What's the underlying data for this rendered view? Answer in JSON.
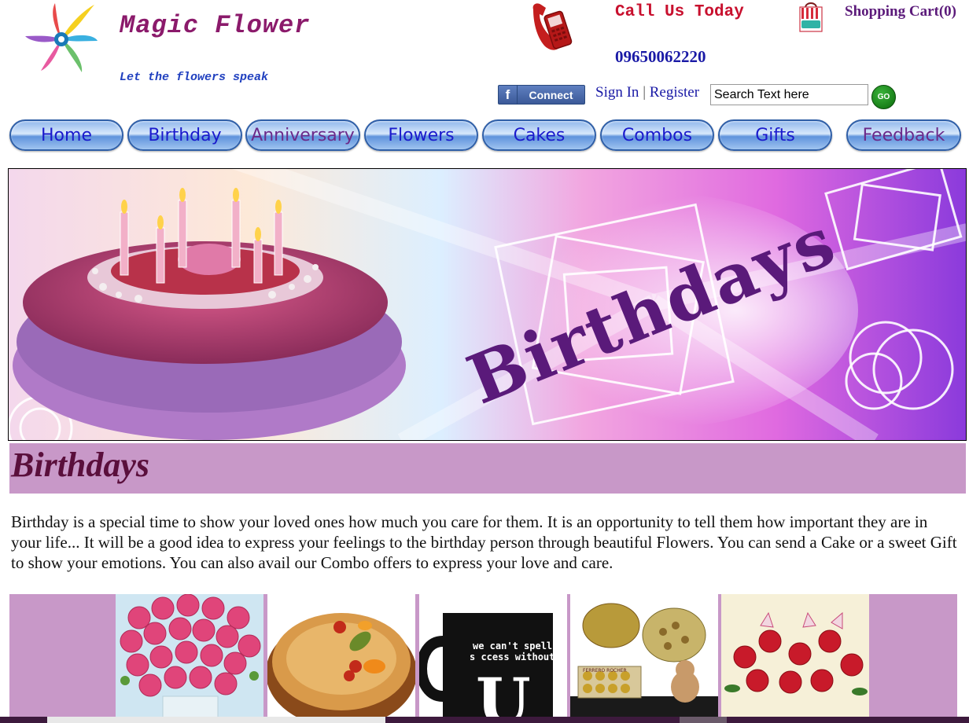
{
  "header": {
    "brand_title": "Magic Flower",
    "tagline": "Let the flowers speak",
    "call_label": "Call Us Today",
    "call_number": "09650062220",
    "cart_label": "Shopping Cart(0)",
    "fb_connect_label": "Connect",
    "sign_in": "Sign In",
    "separator": "|",
    "register": "Register",
    "search_value": "Search Text here",
    "go_label": "GO"
  },
  "nav": {
    "items": [
      {
        "label": "Home"
      },
      {
        "label": "Birthday"
      },
      {
        "label": "Anniversary"
      },
      {
        "label": "Flowers"
      },
      {
        "label": "Cakes"
      },
      {
        "label": "Combos"
      },
      {
        "label": "Gifts"
      },
      {
        "label": "Feedback"
      }
    ]
  },
  "banner": {
    "text": "Birthdays"
  },
  "section": {
    "title": "Birthdays",
    "description": "Birthday is a special time to show your loved ones how much you care for them. It is an opportunity to tell them how important they are in your life... It will be a good idea to express your feelings to the birthday person through beautiful Flowers. You can send a Cake or a sweet Gift to show your emotions. You can also avail our Combo offers to express your love and care."
  },
  "products": {
    "mug_text_1": "we can't spell",
    "mug_text_2": "s ccess without",
    "mug_letter": "U",
    "ferrero_label": "FERRERO ROCHER"
  },
  "colors": {
    "brand": "#8b1a6b",
    "section_bg": "#c898c8",
    "nav_text": "#1a1acc",
    "call_red": "#c8102e"
  }
}
